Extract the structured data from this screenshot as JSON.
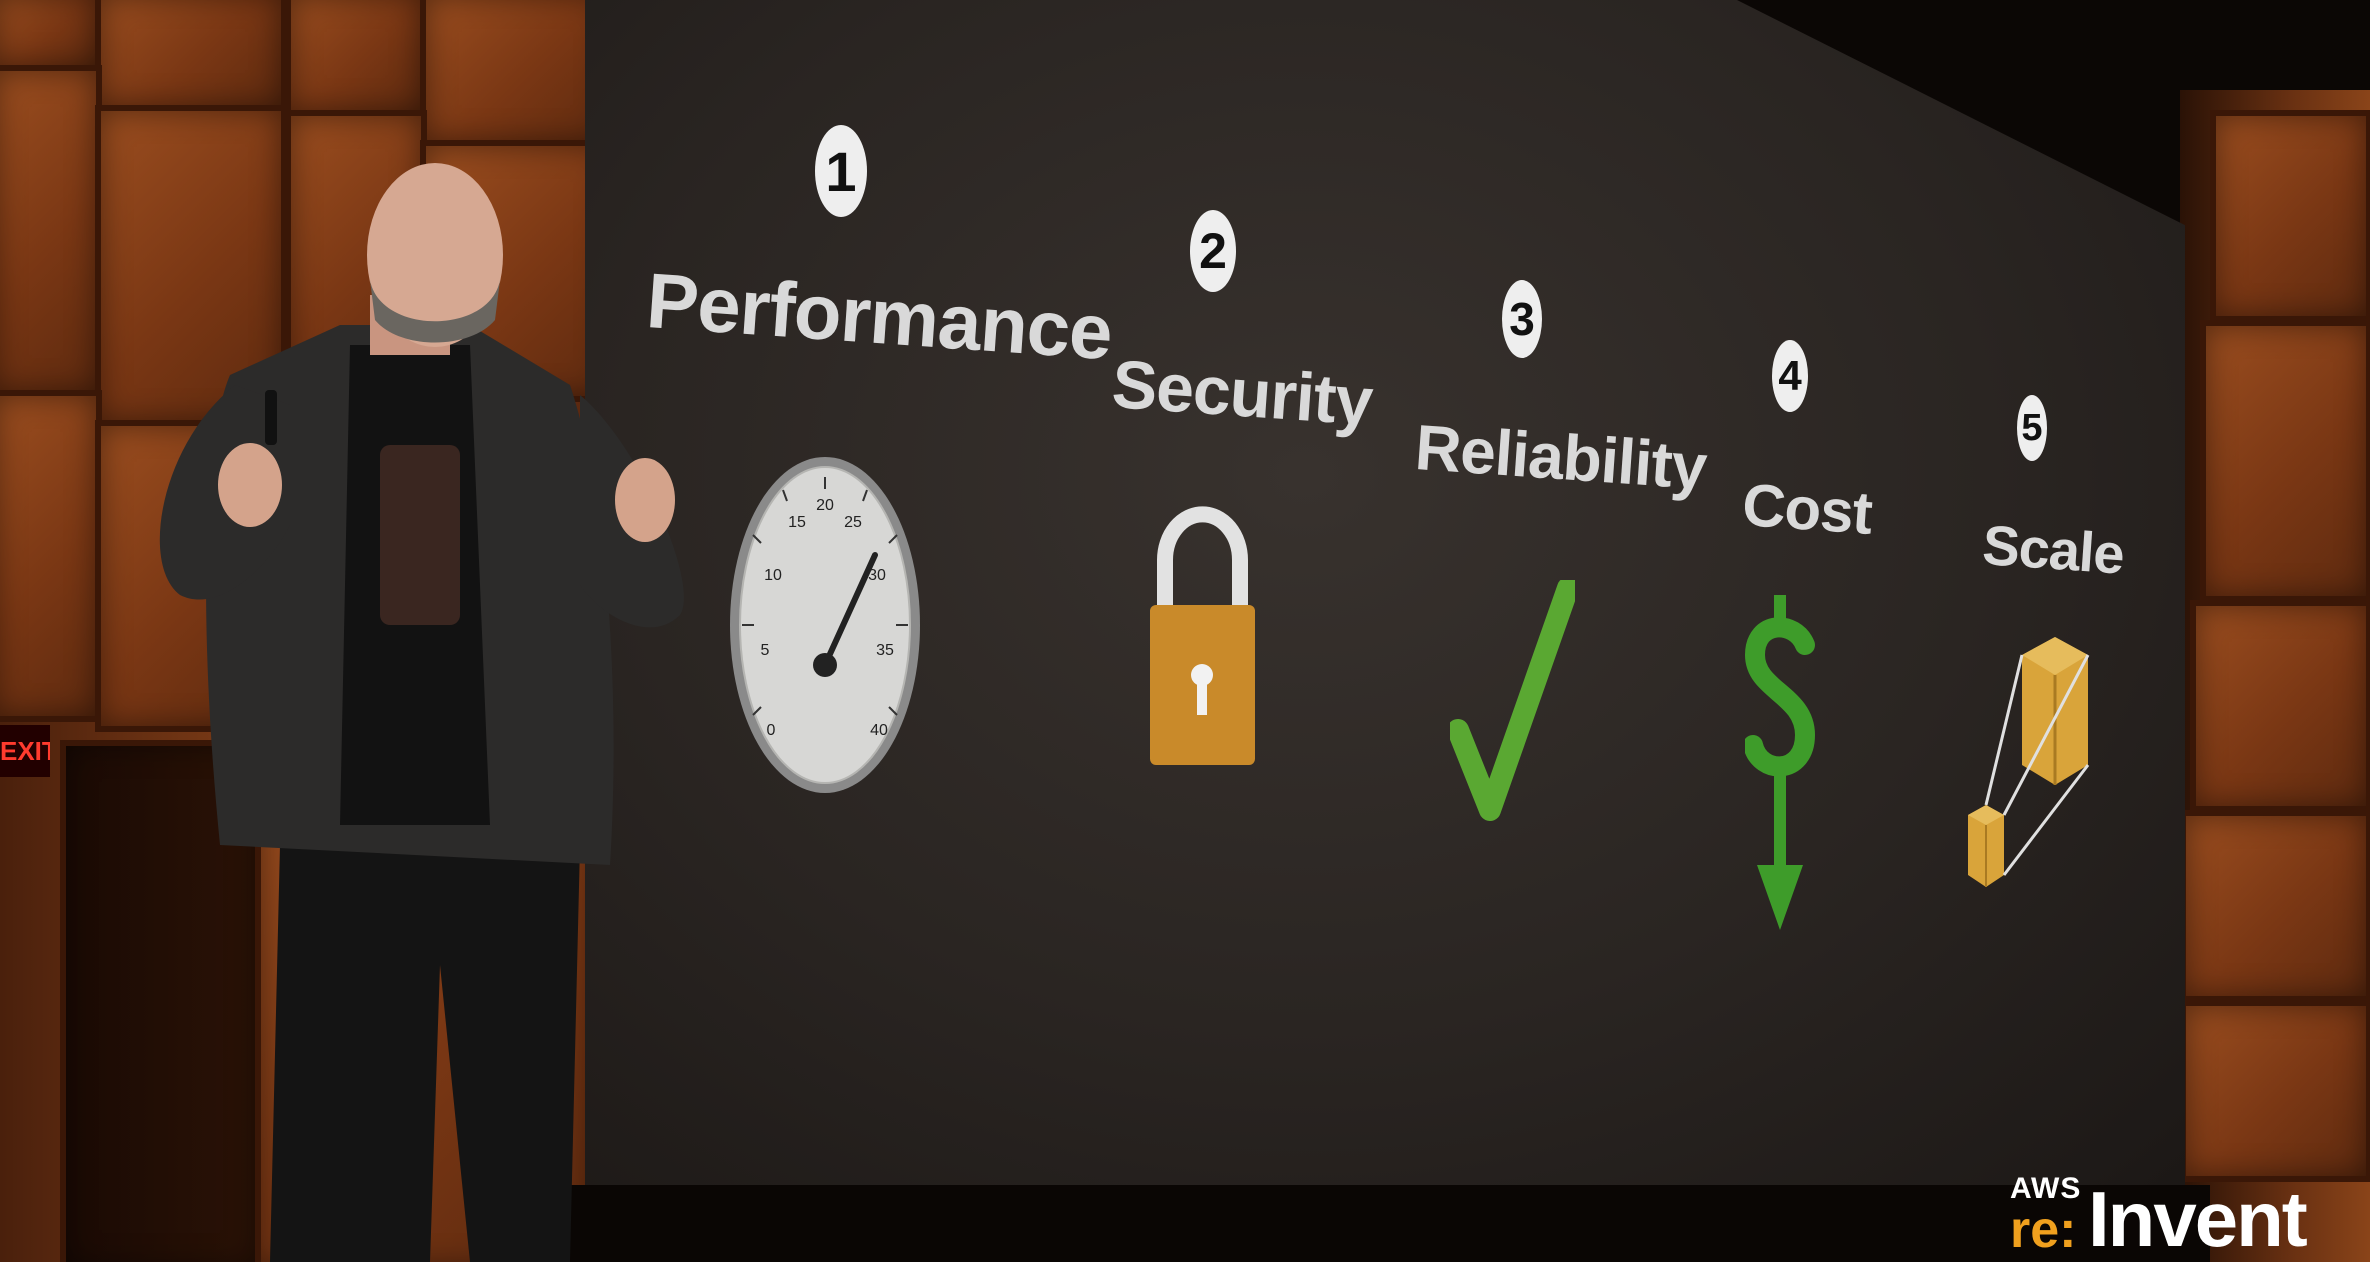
{
  "slide": {
    "pillars": [
      {
        "number": "1",
        "label": "Performance"
      },
      {
        "number": "2",
        "label": "Security"
      },
      {
        "number": "3",
        "label": "Reliability"
      },
      {
        "number": "4",
        "label": "Cost"
      },
      {
        "number": "5",
        "label": "Scale"
      }
    ],
    "gauge_ticks": [
      "0",
      "5",
      "10",
      "15",
      "20",
      "25",
      "30",
      "35",
      "40"
    ]
  },
  "exit_sign": "EXIT",
  "logo": {
    "aws": "AWS",
    "re": "re:",
    "invent": "Invent"
  },
  "colors": {
    "lock_body": "#c98a2a",
    "checkmark": "#5aa832",
    "dollar": "#3e9c2a",
    "boxes": "#d9a43a",
    "logo_accent": "#f0a01e"
  }
}
